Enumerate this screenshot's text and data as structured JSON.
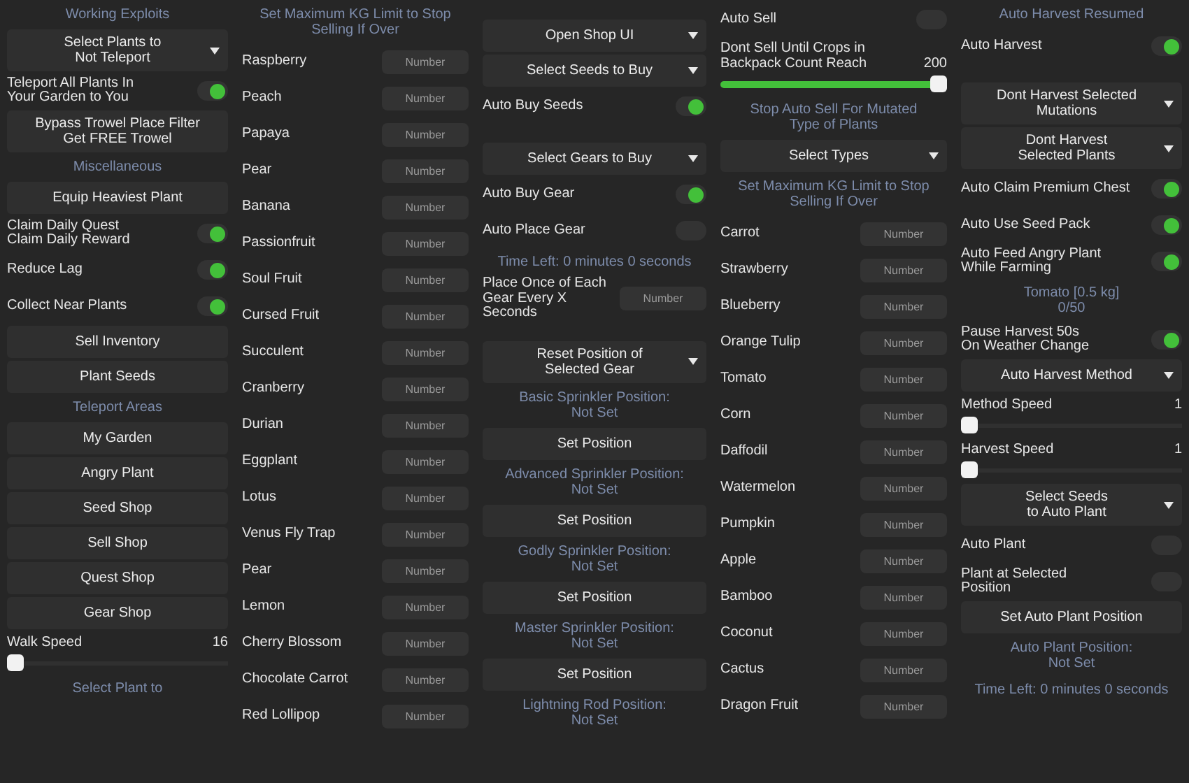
{
  "columns": [
    {
      "items": [
        {
          "kind": "heading",
          "label": "Working Exploits"
        },
        {
          "kind": "dropdown",
          "label": "Select Plants to\nNot Teleport"
        },
        {
          "kind": "toggle",
          "label": "Teleport All Plants In\nYour Garden to You",
          "on": true
        },
        {
          "kind": "button",
          "label": "Bypass Trowel Place Filter\nGet FREE Trowel"
        },
        {
          "kind": "heading",
          "label": "Miscellaneous"
        },
        {
          "kind": "button",
          "label": "Equip Heaviest Plant"
        },
        {
          "kind": "toggle",
          "label": "Claim Daily Quest\nClaim Daily Reward",
          "on": true
        },
        {
          "kind": "toggle",
          "label": "Reduce Lag",
          "on": true
        },
        {
          "kind": "toggle",
          "label": "Collect Near Plants",
          "on": true
        },
        {
          "kind": "button",
          "label": "Sell Inventory"
        },
        {
          "kind": "button",
          "label": "Plant Seeds"
        },
        {
          "kind": "heading",
          "label": "Teleport Areas"
        },
        {
          "kind": "button",
          "label": "My Garden"
        },
        {
          "kind": "button",
          "label": "Angry Plant"
        },
        {
          "kind": "button",
          "label": "Seed Shop"
        },
        {
          "kind": "button",
          "label": "Sell Shop"
        },
        {
          "kind": "button",
          "label": "Quest Shop"
        },
        {
          "kind": "button",
          "label": "Gear Shop"
        },
        {
          "kind": "slider",
          "label": "Walk Speed",
          "value": "16",
          "level": 0
        },
        {
          "kind": "heading",
          "label": "Select Plant to"
        }
      ]
    },
    {
      "items": [
        {
          "kind": "heading",
          "label": "Set Maximum KG Limit to Stop\nSelling If Over"
        },
        {
          "kind": "number",
          "label": "Raspberry",
          "placeholder": "Number"
        },
        {
          "kind": "number",
          "label": "Peach",
          "placeholder": "Number"
        },
        {
          "kind": "number",
          "label": "Papaya",
          "placeholder": "Number"
        },
        {
          "kind": "number",
          "label": "Pear",
          "placeholder": "Number"
        },
        {
          "kind": "number",
          "label": "Banana",
          "placeholder": "Number"
        },
        {
          "kind": "number",
          "label": "Passionfruit",
          "placeholder": "Number"
        },
        {
          "kind": "number",
          "label": "Soul Fruit",
          "placeholder": "Number"
        },
        {
          "kind": "number",
          "label": "Cursed Fruit",
          "placeholder": "Number"
        },
        {
          "kind": "number",
          "label": "Succulent",
          "placeholder": "Number"
        },
        {
          "kind": "number",
          "label": "Cranberry",
          "placeholder": "Number"
        },
        {
          "kind": "number",
          "label": "Durian",
          "placeholder": "Number"
        },
        {
          "kind": "number",
          "label": "Eggplant",
          "placeholder": "Number"
        },
        {
          "kind": "number",
          "label": "Lotus",
          "placeholder": "Number"
        },
        {
          "kind": "number",
          "label": "Venus Fly Trap",
          "placeholder": "Number"
        },
        {
          "kind": "number",
          "label": "Pear",
          "placeholder": "Number"
        },
        {
          "kind": "number",
          "label": "Lemon",
          "placeholder": "Number"
        },
        {
          "kind": "number",
          "label": "Cherry Blossom",
          "placeholder": "Number"
        },
        {
          "kind": "number",
          "label": "Chocolate Carrot",
          "placeholder": "Number"
        },
        {
          "kind": "number",
          "label": "Red Lollipop",
          "placeholder": "Number"
        }
      ]
    },
    {
      "items": [
        {
          "kind": "spacer"
        },
        {
          "kind": "dropdown",
          "label": "Open Shop UI"
        },
        {
          "kind": "dropdown",
          "label": "Select Seeds to Buy"
        },
        {
          "kind": "toggle",
          "label": "Auto Buy Seeds",
          "on": true
        },
        {
          "kind": "spacer"
        },
        {
          "kind": "dropdown",
          "label": "Select Gears to Buy"
        },
        {
          "kind": "toggle",
          "label": "Auto Buy Gear",
          "on": true
        },
        {
          "kind": "toggle",
          "label": "Auto Place Gear",
          "on": false
        },
        {
          "kind": "heading",
          "label": "Time Left: 0 minutes 0 seconds"
        },
        {
          "kind": "number",
          "label": "Place Once of Each\nGear Every X Seconds",
          "placeholder": "Number"
        },
        {
          "kind": "spacer"
        },
        {
          "kind": "dropdown",
          "label": "Reset Position of\nSelected Gear"
        },
        {
          "kind": "heading",
          "label": "Basic Sprinkler Position:\nNot Set"
        },
        {
          "kind": "button",
          "label": "Set Position"
        },
        {
          "kind": "heading",
          "label": "Advanced Sprinkler Position:\nNot Set"
        },
        {
          "kind": "button",
          "label": "Set Position"
        },
        {
          "kind": "heading",
          "label": "Godly Sprinkler Position:\nNot Set"
        },
        {
          "kind": "button",
          "label": "Set Position"
        },
        {
          "kind": "heading",
          "label": "Master Sprinkler Position:\nNot Set"
        },
        {
          "kind": "button",
          "label": "Set Position"
        },
        {
          "kind": "heading",
          "label": "Lightning Rod Position:\nNot Set"
        }
      ]
    },
    {
      "items": [
        {
          "kind": "toggle",
          "label": "Auto Sell",
          "on": false
        },
        {
          "kind": "slider",
          "label": "Dont Sell Until Crops in\nBackpack Count Reach",
          "value": "200",
          "level": 1
        },
        {
          "kind": "heading",
          "label": "Stop Auto Sell For Mutated\nType of Plants"
        },
        {
          "kind": "dropdown",
          "label": "Select Types"
        },
        {
          "kind": "heading",
          "label": "Set Maximum KG Limit to Stop\nSelling If Over"
        },
        {
          "kind": "number",
          "label": "Carrot",
          "placeholder": "Number"
        },
        {
          "kind": "number",
          "label": "Strawberry",
          "placeholder": "Number"
        },
        {
          "kind": "number",
          "label": "Blueberry",
          "placeholder": "Number"
        },
        {
          "kind": "number",
          "label": "Orange Tulip",
          "placeholder": "Number"
        },
        {
          "kind": "number",
          "label": "Tomato",
          "placeholder": "Number"
        },
        {
          "kind": "number",
          "label": "Corn",
          "placeholder": "Number"
        },
        {
          "kind": "number",
          "label": "Daffodil",
          "placeholder": "Number"
        },
        {
          "kind": "number",
          "label": "Watermelon",
          "placeholder": "Number"
        },
        {
          "kind": "number",
          "label": "Pumpkin",
          "placeholder": "Number"
        },
        {
          "kind": "number",
          "label": "Apple",
          "placeholder": "Number"
        },
        {
          "kind": "number",
          "label": "Bamboo",
          "placeholder": "Number"
        },
        {
          "kind": "number",
          "label": "Coconut",
          "placeholder": "Number"
        },
        {
          "kind": "number",
          "label": "Cactus",
          "placeholder": "Number"
        },
        {
          "kind": "number",
          "label": "Dragon Fruit",
          "placeholder": "Number"
        }
      ]
    },
    {
      "items": [
        {
          "kind": "heading",
          "label": "Auto Harvest Resumed"
        },
        {
          "kind": "toggle",
          "label": "Auto Harvest",
          "on": true
        },
        {
          "kind": "spacer"
        },
        {
          "kind": "dropdown",
          "label": "Dont Harvest Selected\nMutations"
        },
        {
          "kind": "dropdown",
          "label": "Dont Harvest\nSelected Plants"
        },
        {
          "kind": "toggle",
          "label": "Auto Claim Premium Chest",
          "on": true
        },
        {
          "kind": "toggle",
          "label": "Auto Use Seed Pack",
          "on": true
        },
        {
          "kind": "toggle",
          "label": "Auto Feed Angry Plant\nWhile Farming",
          "on": true
        },
        {
          "kind": "heading",
          "label": "Tomato [0.5 kg]\n0/50"
        },
        {
          "kind": "toggle",
          "label": "Pause Harvest 50s\nOn Weather Change",
          "on": true
        },
        {
          "kind": "dropdown",
          "label": "Auto Harvest Method"
        },
        {
          "kind": "slider",
          "label": "Method Speed",
          "value": "1",
          "level": 0
        },
        {
          "kind": "slider",
          "label": "Harvest Speed",
          "value": "1",
          "level": 0
        },
        {
          "kind": "dropdown",
          "label": "Select Seeds\nto Auto Plant"
        },
        {
          "kind": "toggle",
          "label": "Auto Plant",
          "on": false
        },
        {
          "kind": "toggle",
          "label": "Plant at Selected\nPosition",
          "on": false
        },
        {
          "kind": "button",
          "label": "Set Auto Plant Position"
        },
        {
          "kind": "heading",
          "label": "Auto Plant Position:\nNot Set"
        },
        {
          "kind": "heading",
          "label": "Time Left: 0 minutes 0 seconds"
        }
      ]
    }
  ]
}
